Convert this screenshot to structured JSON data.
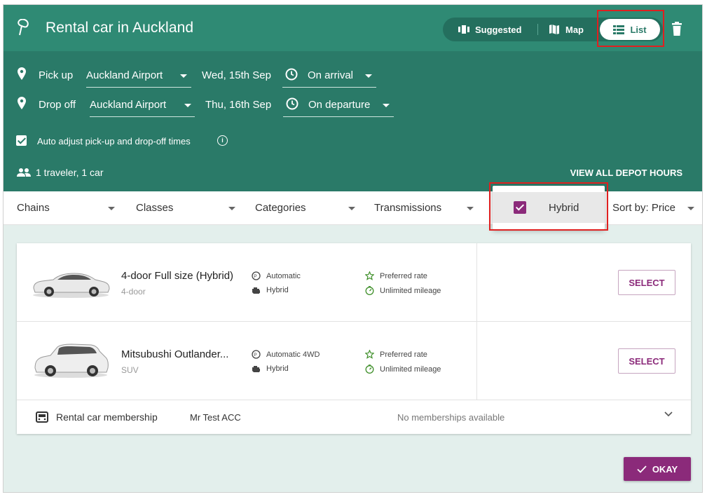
{
  "colors": {
    "header": "#2a7a68",
    "header_top": "#2f8a74",
    "accent": "#8b2a7a",
    "highlight": "#e02020"
  },
  "header": {
    "title": "Rental car in Auckland",
    "title_icon": "location-flag-icon",
    "views": {
      "suggested": "Suggested",
      "map": "Map",
      "list": "List"
    },
    "selected_view": "List"
  },
  "pickup": {
    "label": "Pick up",
    "location": "Auckland Airport",
    "date": "Wed, 15th Sep",
    "time": "On arrival"
  },
  "dropoff": {
    "label": "Drop off",
    "location": "Auckland Airport",
    "date": "Thu, 16th Sep",
    "time": "On departure"
  },
  "auto_adjust": {
    "label": "Auto adjust pick-up and drop-off times",
    "checked": true
  },
  "travelers": "1 traveler, 1 car",
  "depot_hours": "VIEW ALL DEPOT HOURS",
  "filters": {
    "chains": "Chains",
    "classes": "Classes",
    "categories": "Categories",
    "transmissions": "Transmissions",
    "sort": "Sort by: Price"
  },
  "hybrid_option": {
    "label": "Hybrid",
    "checked": true
  },
  "cars": [
    {
      "name": "4-door Full size (Hybrid)",
      "type": "4-door",
      "transmission": "Automatic",
      "fuel": "Hybrid",
      "rate": "Preferred rate",
      "mileage": "Unlimited mileage",
      "select": "SELECT"
    },
    {
      "name": "Mitsubushi Outlander...",
      "type": "SUV",
      "transmission": "Automatic 4WD",
      "fuel": "Hybrid",
      "rate": "Preferred rate",
      "mileage": "Unlimited mileage",
      "select": "SELECT"
    }
  ],
  "membership": {
    "label": "Rental car membership",
    "name": "Mr Test ACC",
    "status": "No memberships available"
  },
  "okay": "OKAY"
}
